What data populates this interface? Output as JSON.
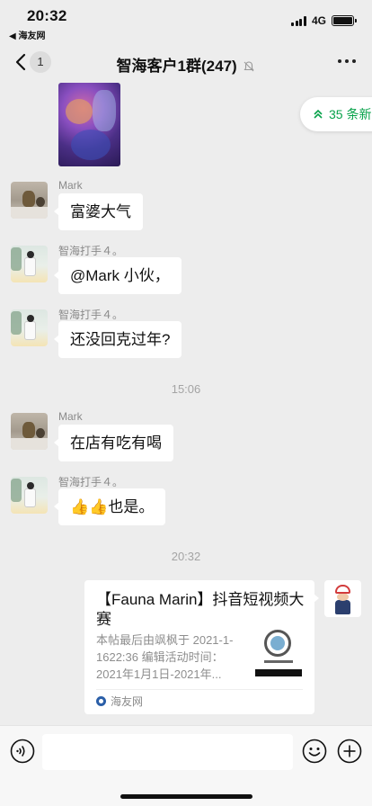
{
  "status_bar": {
    "time": "20:32",
    "back_app": "◀ 海友网",
    "network": "4G"
  },
  "nav": {
    "unread_badge": "1",
    "title": "智海客户1群(247)"
  },
  "new_messages_pill": "35 条新",
  "messages": [
    {
      "sender": "Mark",
      "text": "富婆大气"
    },
    {
      "sender": "智海打手４。",
      "text": "@Mark 小伙，"
    },
    {
      "sender": "智海打手４。",
      "text": "还没回克过年?"
    },
    {
      "sender": "Mark",
      "text": "在店有吃有喝"
    },
    {
      "sender": "智海打手４。",
      "text": "👍👍也是。"
    }
  ],
  "time_separators": [
    "15:06",
    "20:32"
  ],
  "link_card": {
    "title": "【Fauna Marin】抖音短视频大赛",
    "description": "本帖最后由飒枫于 2021-1-1622:36 编辑活动时间：2021年1月1日-2021年...",
    "source": "海友网"
  },
  "colors": {
    "background": "#ededed",
    "accent_green": "#07a24a",
    "bubble": "#ffffff"
  }
}
